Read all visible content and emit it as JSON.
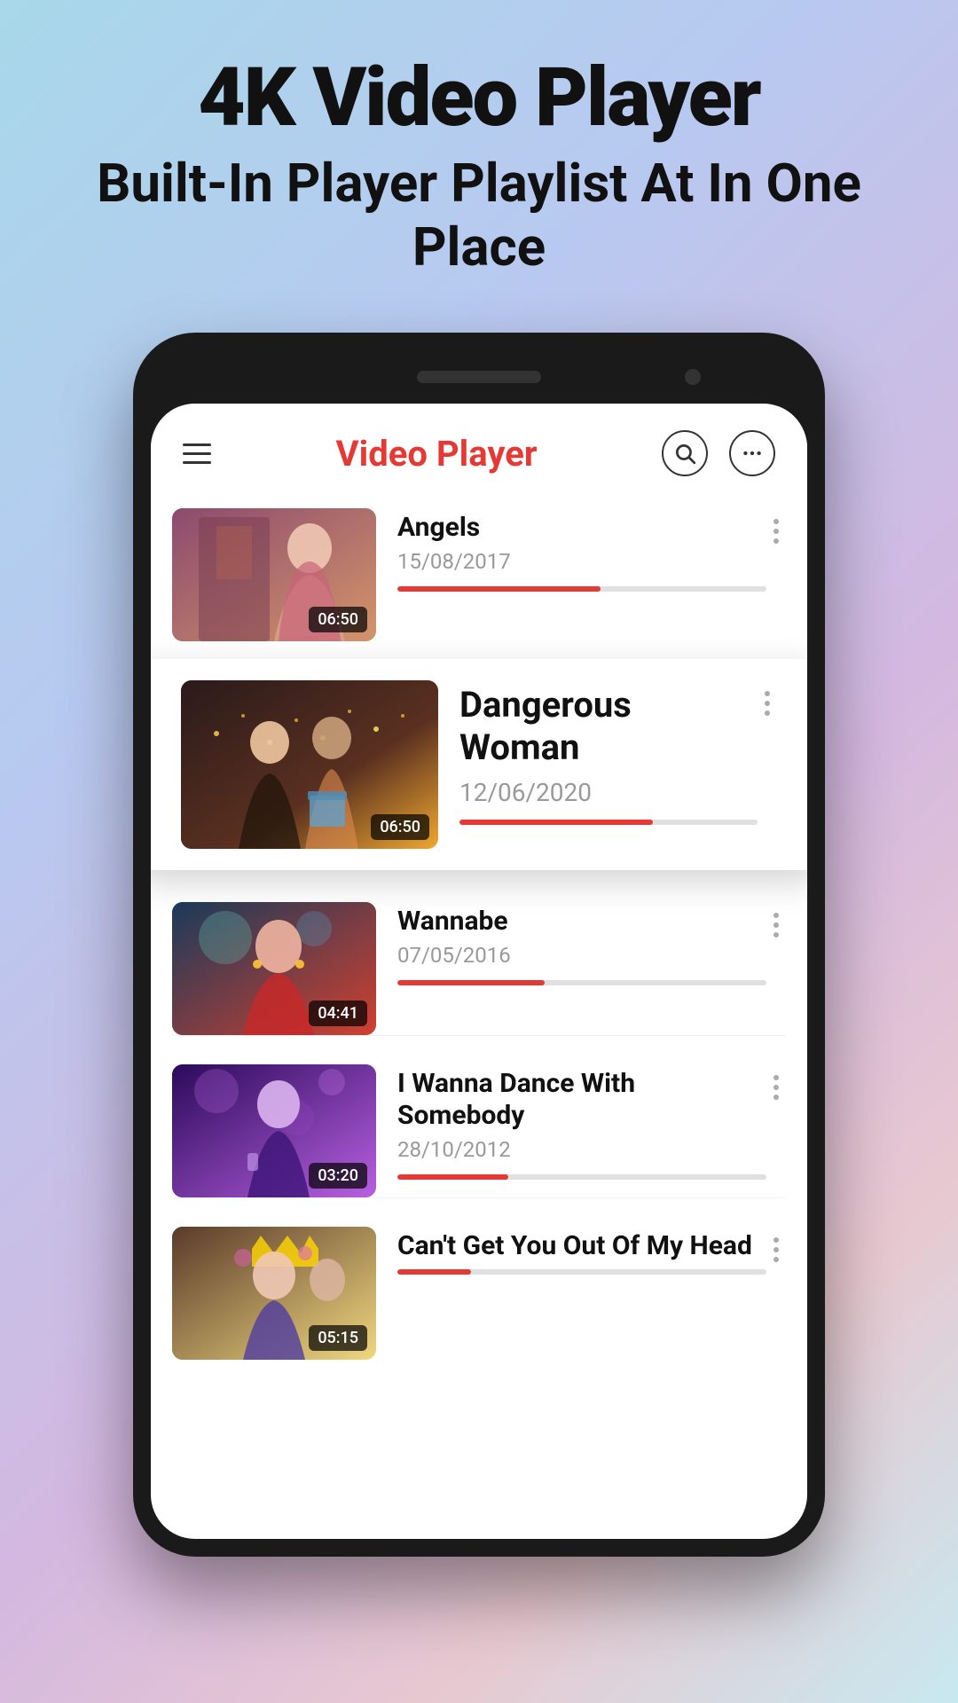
{
  "header": {
    "main_title": "4K Video Player",
    "sub_title": "Built-In Player Playlist At In One Place"
  },
  "app": {
    "title": "Video Player",
    "search_label": "Search",
    "more_label": "More options"
  },
  "videos": [
    {
      "id": 1,
      "title": "Angels",
      "date": "15/08/2017",
      "duration": "06:50",
      "progress": 55,
      "highlighted": false,
      "thumb_class": "thumb-1"
    },
    {
      "id": 2,
      "title": "Dangerous Woman",
      "date": "12/06/2020",
      "duration": "06:50",
      "progress": 65,
      "highlighted": true,
      "thumb_class": "thumb-2"
    },
    {
      "id": 3,
      "title": "Wannabe",
      "date": "07/05/2016",
      "duration": "04:41",
      "progress": 40,
      "highlighted": false,
      "thumb_class": "thumb-3"
    },
    {
      "id": 4,
      "title": "I Wanna Dance With Somebody",
      "date": "28/10/2012",
      "duration": "03:20",
      "progress": 30,
      "highlighted": false,
      "thumb_class": "thumb-4"
    },
    {
      "id": 5,
      "title": "Can't Get You Out Of My Head",
      "date": "",
      "duration": "05:15",
      "progress": 20,
      "highlighted": false,
      "thumb_class": "thumb-5"
    }
  ]
}
